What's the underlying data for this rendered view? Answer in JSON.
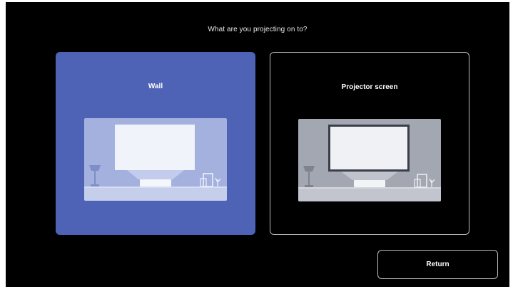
{
  "dialog": {
    "prompt": "What are you projecting on to?",
    "options": [
      {
        "label": "Wall",
        "selected": true
      },
      {
        "label": "Projector screen",
        "selected": false
      }
    ],
    "return_label": "Return"
  },
  "colors": {
    "background": "#000000",
    "selected_card": "#4e63b5",
    "card_border": "#bcbcbc",
    "text": "#ffffff"
  }
}
